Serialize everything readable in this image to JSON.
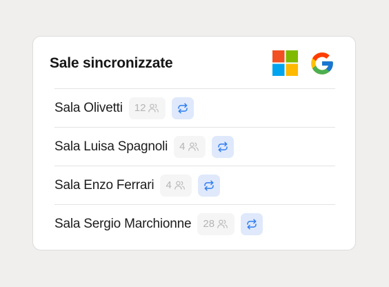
{
  "card": {
    "title": "Sale sincronizzate",
    "providers": [
      "microsoft-logo",
      "google-logo"
    ]
  },
  "rooms": [
    {
      "name": "Sala Olivetti",
      "capacity": "12"
    },
    {
      "name": "Sala Luisa Spagnoli",
      "capacity": "4"
    },
    {
      "name": "Sala Enzo Ferrari",
      "capacity": "4"
    },
    {
      "name": "Sala Sergio Marchionne",
      "capacity": "28"
    }
  ],
  "icons": {
    "capacity": "people-icon",
    "sync": "sync-icon"
  },
  "colors": {
    "background": "#f0efed",
    "sync_button_bg": "#dfe9fb",
    "sync_icon": "#2f7df0",
    "capacity_text": "#b4b4b4"
  }
}
